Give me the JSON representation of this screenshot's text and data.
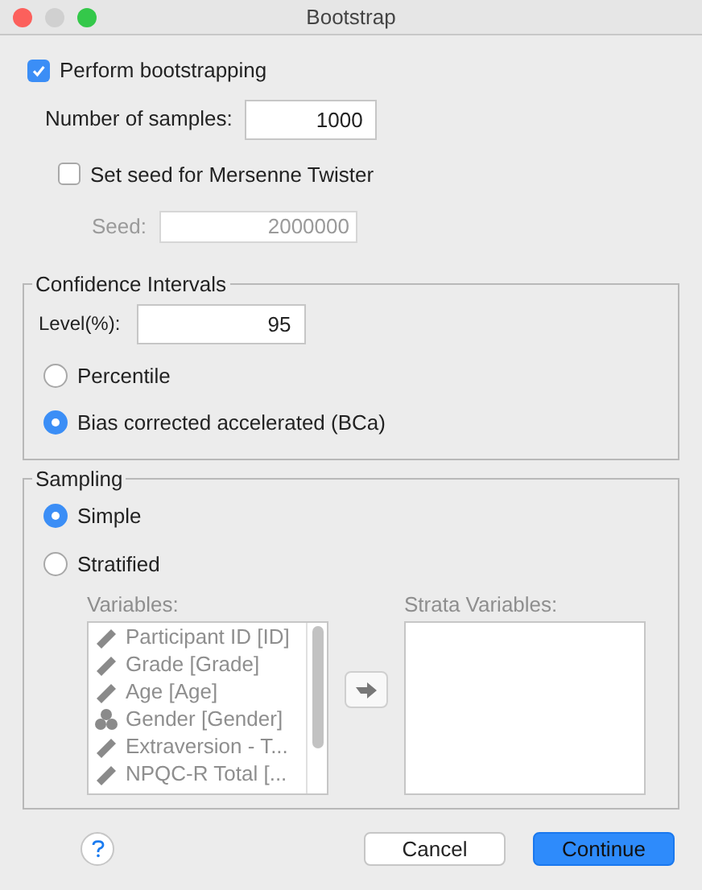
{
  "window": {
    "title": "Bootstrap"
  },
  "perform": {
    "label": "Perform bootstrapping",
    "checked": true
  },
  "samples": {
    "label": "Number of samples:",
    "value": "1000"
  },
  "seed_option": {
    "label": "Set seed for Mersenne Twister",
    "checked": false
  },
  "seed": {
    "label": "Seed:",
    "value": "2000000",
    "disabled": true
  },
  "confidence": {
    "title": "Confidence Intervals",
    "level_label": "Level(%):",
    "level_value": "95",
    "options": [
      {
        "label": "Percentile",
        "selected": false
      },
      {
        "label": "Bias corrected accelerated (BCa)",
        "selected": true
      }
    ]
  },
  "sampling": {
    "title": "Sampling",
    "options": [
      {
        "label": "Simple",
        "selected": true
      },
      {
        "label": "Stratified",
        "selected": false
      }
    ],
    "variables_label": "Variables:",
    "strata_label": "Strata Variables:",
    "disabled": true,
    "variables": [
      {
        "name": "Participant ID [ID]",
        "kind": "scale"
      },
      {
        "name": "Grade [Grade]",
        "kind": "scale"
      },
      {
        "name": "Age [Age]",
        "kind": "scale"
      },
      {
        "name": "Gender [Gender]",
        "kind": "nominal"
      },
      {
        "name": "Extraversion - T...",
        "kind": "scale"
      },
      {
        "name": "NPQC-R Total [...",
        "kind": "scale"
      }
    ]
  },
  "buttons": [
    {
      "label": "Cancel",
      "kind": "default"
    },
    {
      "label": "Continue",
      "kind": "primary"
    }
  ]
}
